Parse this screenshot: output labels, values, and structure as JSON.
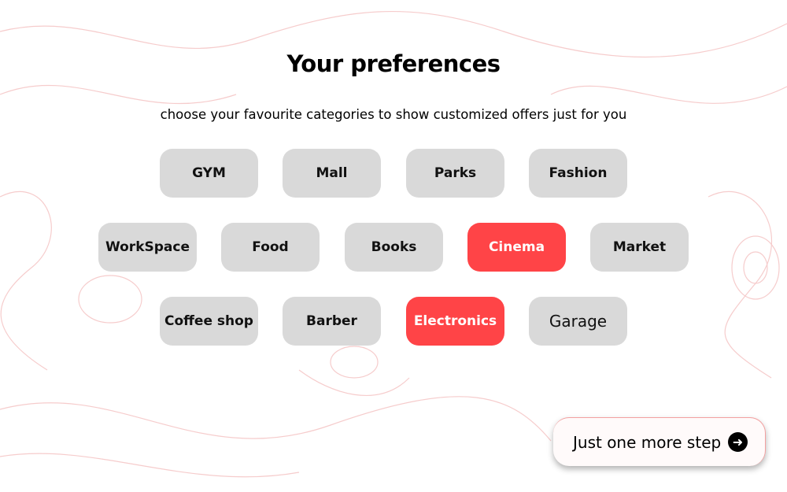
{
  "title": "Your preferences",
  "subtitle": "choose your favourite categories to show customized offers just for you",
  "colors": {
    "selected": "#FF4447",
    "unselected": "#D9D9D9"
  },
  "categories": [
    {
      "label": "GYM",
      "selected": false
    },
    {
      "label": "Mall",
      "selected": false
    },
    {
      "label": "Parks",
      "selected": false
    },
    {
      "label": "Fashion",
      "selected": false
    },
    {
      "label": "WorkSpace",
      "selected": false
    },
    {
      "label": "Food",
      "selected": false
    },
    {
      "label": "Books",
      "selected": false
    },
    {
      "label": "Cinema",
      "selected": true
    },
    {
      "label": "Market",
      "selected": false
    },
    {
      "label": "Coffee shop",
      "selected": false
    },
    {
      "label": "Barber",
      "selected": false
    },
    {
      "label": "Electronics",
      "selected": true
    },
    {
      "label": "Garage",
      "selected": false
    }
  ],
  "next_button": {
    "label": "Just one more step",
    "icon": "arrow-right-circle-icon"
  }
}
